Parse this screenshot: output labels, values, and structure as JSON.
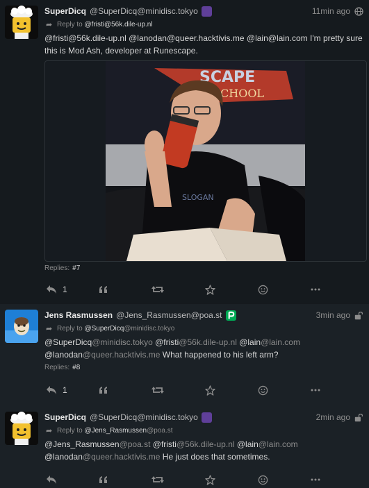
{
  "posts": [
    {
      "name": "SuperDicq",
      "handle": "@SuperDicq@minidisc.tokyo",
      "time": "11min ago",
      "reply_prefix": "Reply to",
      "reply_to_user": "@fristi",
      "reply_to_domain": "@56k.dile-up.nl",
      "mentions": [
        {
          "user": "@fristi",
          "domain": "@56k.dile-up.nl"
        },
        {
          "user": "@lanodan",
          "domain": "@queer.hacktivis.me"
        },
        {
          "user": "@lain",
          "domain": "@lain.com"
        }
      ],
      "text": "I'm pretty sure this is Mod Ash, developer at Runescape.",
      "image_caption": "SCAPE SCHOOL",
      "replies_label": "Replies:",
      "replies_value": "#7",
      "reply_count": "1",
      "visibility_icon": "globe-icon"
    },
    {
      "name": "Jens Rasmussen",
      "handle": "@Jens_Rasmussen@poa.st",
      "time": "3min ago",
      "reply_prefix": "Reply to",
      "reply_to_user": "@SuperDicq",
      "reply_to_domain": "@minidisc.tokyo",
      "mentions": [
        {
          "user": "@SuperDicq",
          "domain": "@minidisc.tokyo"
        },
        {
          "user": "@fristi",
          "domain": "@56k.dile-up.nl"
        },
        {
          "user": "@lain",
          "domain": "@lain.com"
        },
        {
          "user": "@lanodan",
          "domain": "@queer.hacktivis.me"
        }
      ],
      "text": "What happened to his left arm?",
      "replies_label": "Replies:",
      "replies_value": "#8",
      "reply_count": "1",
      "visibility_icon": "lock-open-icon"
    },
    {
      "name": "SuperDicq",
      "handle": "@SuperDicq@minidisc.tokyo",
      "time": "2min ago",
      "reply_prefix": "Reply to",
      "reply_to_user": "@Jens_Rasmussen",
      "reply_to_domain": "@poa.st",
      "mentions": [
        {
          "user": "@Jens_Rasmussen",
          "domain": "@poa.st"
        },
        {
          "user": "@fristi",
          "domain": "@56k.dile-up.nl"
        },
        {
          "user": "@lain",
          "domain": "@lain.com"
        },
        {
          "user": "@lanodan",
          "domain": "@queer.hacktivis.me"
        }
      ],
      "text": "He just does that sometimes.",
      "visibility_icon": "lock-open-icon"
    }
  ],
  "colors": {
    "background": "#1b2126",
    "highlight_background": "#151a1e",
    "accent_purple": "#5f3f99",
    "poa_green": "#00aa55"
  },
  "icons": [
    "reply-icon",
    "quote-icon",
    "repeat-icon",
    "star-icon",
    "smile-icon",
    "more-icon"
  ]
}
